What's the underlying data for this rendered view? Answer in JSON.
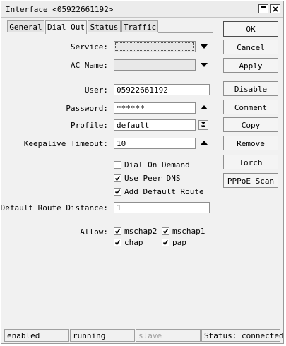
{
  "window": {
    "title": "Interface <05922661192>"
  },
  "titlebar": {
    "maximize_icon": "maximize-icon",
    "close_icon": "close-icon"
  },
  "tabs": [
    {
      "label": "General"
    },
    {
      "label": "Dial Out",
      "active": true
    },
    {
      "label": "Status"
    },
    {
      "label": "Traffic"
    }
  ],
  "form": {
    "service": {
      "label": "Service:",
      "value": ""
    },
    "ac_name": {
      "label": "AC Name:",
      "value": ""
    },
    "user": {
      "label": "User:",
      "value": "05922661192"
    },
    "password": {
      "label": "Password:",
      "value": "******"
    },
    "profile": {
      "label": "Profile:",
      "value": "default"
    },
    "keepalive": {
      "label": "Keepalive Timeout:",
      "value": "10"
    },
    "dial_on_demand": {
      "label": "Dial On Demand",
      "checked": false
    },
    "use_peer_dns": {
      "label": "Use Peer DNS",
      "checked": true
    },
    "add_default_route": {
      "label": "Add Default Route",
      "checked": true
    },
    "default_route_distance": {
      "label": "Default Route Distance:",
      "value": "1"
    },
    "allow": {
      "label": "Allow:",
      "options": [
        {
          "label": "mschap2",
          "checked": true
        },
        {
          "label": "mschap1",
          "checked": true
        },
        {
          "label": "chap",
          "checked": true
        },
        {
          "label": "pap",
          "checked": true
        }
      ]
    }
  },
  "buttons": {
    "ok": "OK",
    "cancel": "Cancel",
    "apply": "Apply",
    "disable": "Disable",
    "comment": "Comment",
    "copy": "Copy",
    "remove": "Remove",
    "torch": "Torch",
    "pppoe_scan": "PPPoE Scan"
  },
  "statusbar": {
    "state": "enabled",
    "running": "running",
    "slave": "slave",
    "status": "Status: connected"
  }
}
